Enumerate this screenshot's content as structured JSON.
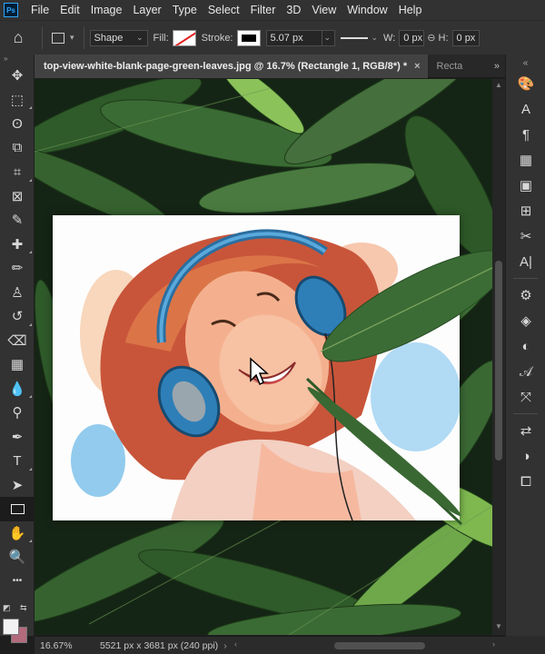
{
  "app": {
    "logo": "Ps"
  },
  "menu": [
    "File",
    "Edit",
    "Image",
    "Layer",
    "Type",
    "Select",
    "Filter",
    "3D",
    "View",
    "Window",
    "Help"
  ],
  "options": {
    "mode": "Shape",
    "fill_label": "Fill:",
    "stroke_label": "Stroke:",
    "stroke_width": "5.07 px",
    "w_label": "W:",
    "w_value": "0 px",
    "h_label": "H:",
    "h_value": "0 px"
  },
  "tabs": {
    "active": "top-view-white-blank-page-green-leaves.jpg @ 16.7% (Rectangle 1, RGB/8*) *",
    "active_close": "×",
    "inactive": "Recta",
    "more": "»"
  },
  "status": {
    "zoom": "16.67%",
    "doc_info": "5521 px x 3681 px (240 ppi)",
    "arrow": "›"
  },
  "toolbar": {
    "collapse": "»",
    "icons": [
      "move-icon",
      "marquee-icon",
      "lasso-icon",
      "object-select-icon",
      "crop-icon",
      "frame-icon",
      "eyedropper-icon",
      "healing-brush-icon",
      "brush-icon",
      "clone-stamp-icon",
      "history-brush-icon",
      "eraser-icon",
      "gradient-icon",
      "blur-icon",
      "dodge-icon",
      "pen-icon",
      "type-icon",
      "path-select-icon",
      "rectangle-icon",
      "hand-icon",
      "zoom-icon",
      "more-tools-icon"
    ],
    "glyphs": [
      "✥",
      "⬚",
      "ʘ",
      "⧉",
      "⌗",
      "⊠",
      "✎",
      "✚",
      "✏",
      "♙",
      "↺",
      "⌫",
      "▦",
      "💧",
      "⚲",
      "✒",
      "T",
      "➤",
      "▭",
      "✋",
      "🔍",
      "•••"
    ],
    "active_index": 18,
    "fg_color": "#f2f2f2",
    "bg_color": "#b46a7d"
  },
  "rpanel": {
    "collapse": "«",
    "icons": [
      "color-icon",
      "character-style-icon",
      "paragraph-icon",
      "swatches-icon",
      "gradient-panel-icon",
      "grid-icon",
      "tools-icon",
      "glyph-icon",
      "adjustments-icon",
      "layers-icon",
      "channels-icon",
      "character-icon",
      "paths-icon",
      "history-icon",
      "properties-icon",
      "libraries-icon"
    ],
    "glyphs": [
      "🎨",
      "A",
      "¶",
      "▦",
      "▣",
      "⊞",
      "✂",
      "A|",
      "⚙",
      "◈",
      "◐",
      "𝒜",
      "⤧",
      "⇄",
      "◑",
      "⧠"
    ]
  },
  "colors": {
    "accent": "#31a8ff",
    "panel": "#323232",
    "canvas_bg": "#1c2a1c"
  }
}
